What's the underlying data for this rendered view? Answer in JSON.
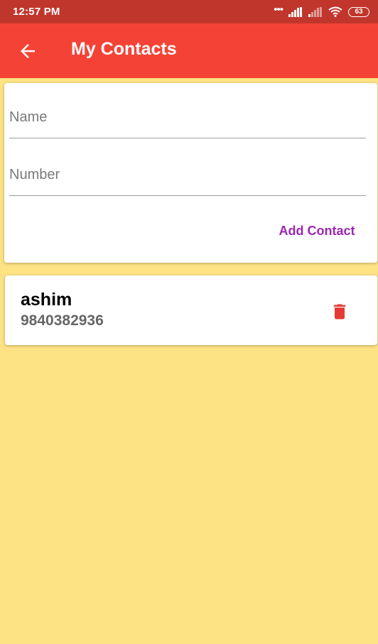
{
  "status_bar": {
    "time": "12:57 PM",
    "battery": "63"
  },
  "app_bar": {
    "title": "My Contacts",
    "back_icon": "arrow-back-icon"
  },
  "form": {
    "name_placeholder": "Name",
    "name_value": "",
    "number_placeholder": "Number",
    "number_value": "",
    "add_label": "Add Contact"
  },
  "contacts": [
    {
      "name": "ashim",
      "number": "9840382936",
      "delete_icon": "trash-icon"
    }
  ],
  "colors": {
    "status_bar": "#c1362c",
    "app_bar": "#f44336",
    "background": "#fde384",
    "accent": "#9c27b0",
    "delete": "#e53935"
  }
}
